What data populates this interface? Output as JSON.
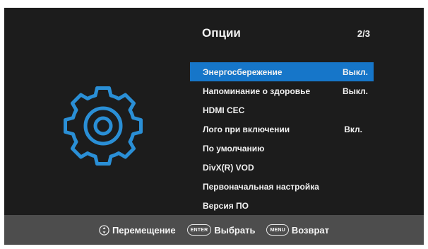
{
  "header": {
    "title": "Опции",
    "page": "2/3"
  },
  "menu": {
    "items": [
      {
        "label": "Энергосбережение",
        "value": "Выкл.",
        "selected": true
      },
      {
        "label": "Напоминание о здоровье",
        "value": "Выкл."
      },
      {
        "label": "HDMI CEC",
        "value": ""
      },
      {
        "label": "Лого при включении",
        "value": "Вкл."
      },
      {
        "label": "По умолчанию",
        "value": ""
      },
      {
        "label": "DivX(R) VOD",
        "value": ""
      },
      {
        "label": "Первоначальная настройка",
        "value": ""
      },
      {
        "label": "Версия ПО",
        "value": ""
      }
    ]
  },
  "footer": {
    "move_label": "Перемещение",
    "enter_key": "ENTER",
    "enter_label": "Выбрать",
    "menu_key": "MENU",
    "menu_label": "Возврат"
  },
  "colors": {
    "background": "#1c1c1c",
    "accent": "#1676c9",
    "icon": "#2a8fd6",
    "footer": "#4d4d4d"
  },
  "icons": {
    "main": "gear-icon",
    "move": "up-down-nav-icon"
  }
}
